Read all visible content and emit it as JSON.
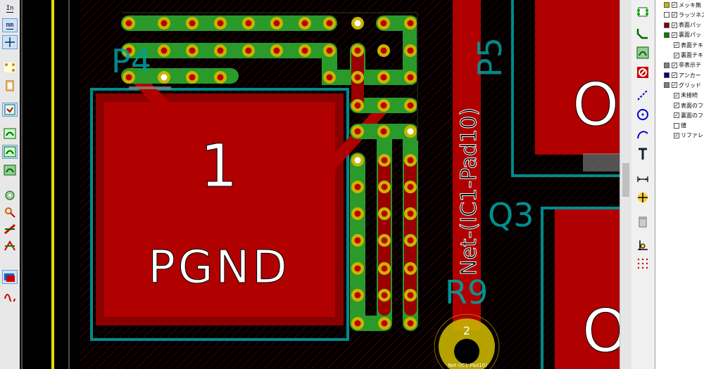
{
  "left_toolbar": {
    "units_in": "In",
    "units_mm": "mm"
  },
  "canvas": {
    "ref_p4": "P4",
    "ref_p5": "P5",
    "ref_q3": "Q3",
    "ref_r9": "R9",
    "pad_number": "1",
    "pad_net": "PGND",
    "net_label": "Net-(IC1-Pad10)",
    "via_pad_number": "2",
    "via_pad_net": "Net-(IC1-Pad10)",
    "big_pad_o_top": "O",
    "big_pad_o_bottom": "O"
  },
  "layers": [
    {
      "label": "メッキ無",
      "color": "#c8b400",
      "checked": true
    },
    {
      "label": "ラッツネス",
      "color": "#ffffff",
      "checked": true
    },
    {
      "label": "表面パッ",
      "color": "#8b0000",
      "checked": true
    },
    {
      "label": "裏面パッ",
      "color": "#008000",
      "checked": true
    },
    {
      "label": "表面テキ",
      "color": null,
      "checked": true
    },
    {
      "label": "裏面テキ",
      "color": null,
      "checked": true
    },
    {
      "label": "非表示テ",
      "color": "#808080",
      "checked": true
    },
    {
      "label": "アンカー",
      "color": "#000080",
      "checked": true
    },
    {
      "label": "グリッド",
      "color": "#808080",
      "checked": true
    },
    {
      "label": "未接続",
      "color": null,
      "checked": true
    },
    {
      "label": "表面のフ",
      "color": null,
      "checked": true
    },
    {
      "label": "裏面のフ",
      "color": null,
      "checked": true
    },
    {
      "label": "値",
      "color": null,
      "checked": false
    },
    {
      "label": "リファレン",
      "color": null,
      "checked": true
    }
  ]
}
